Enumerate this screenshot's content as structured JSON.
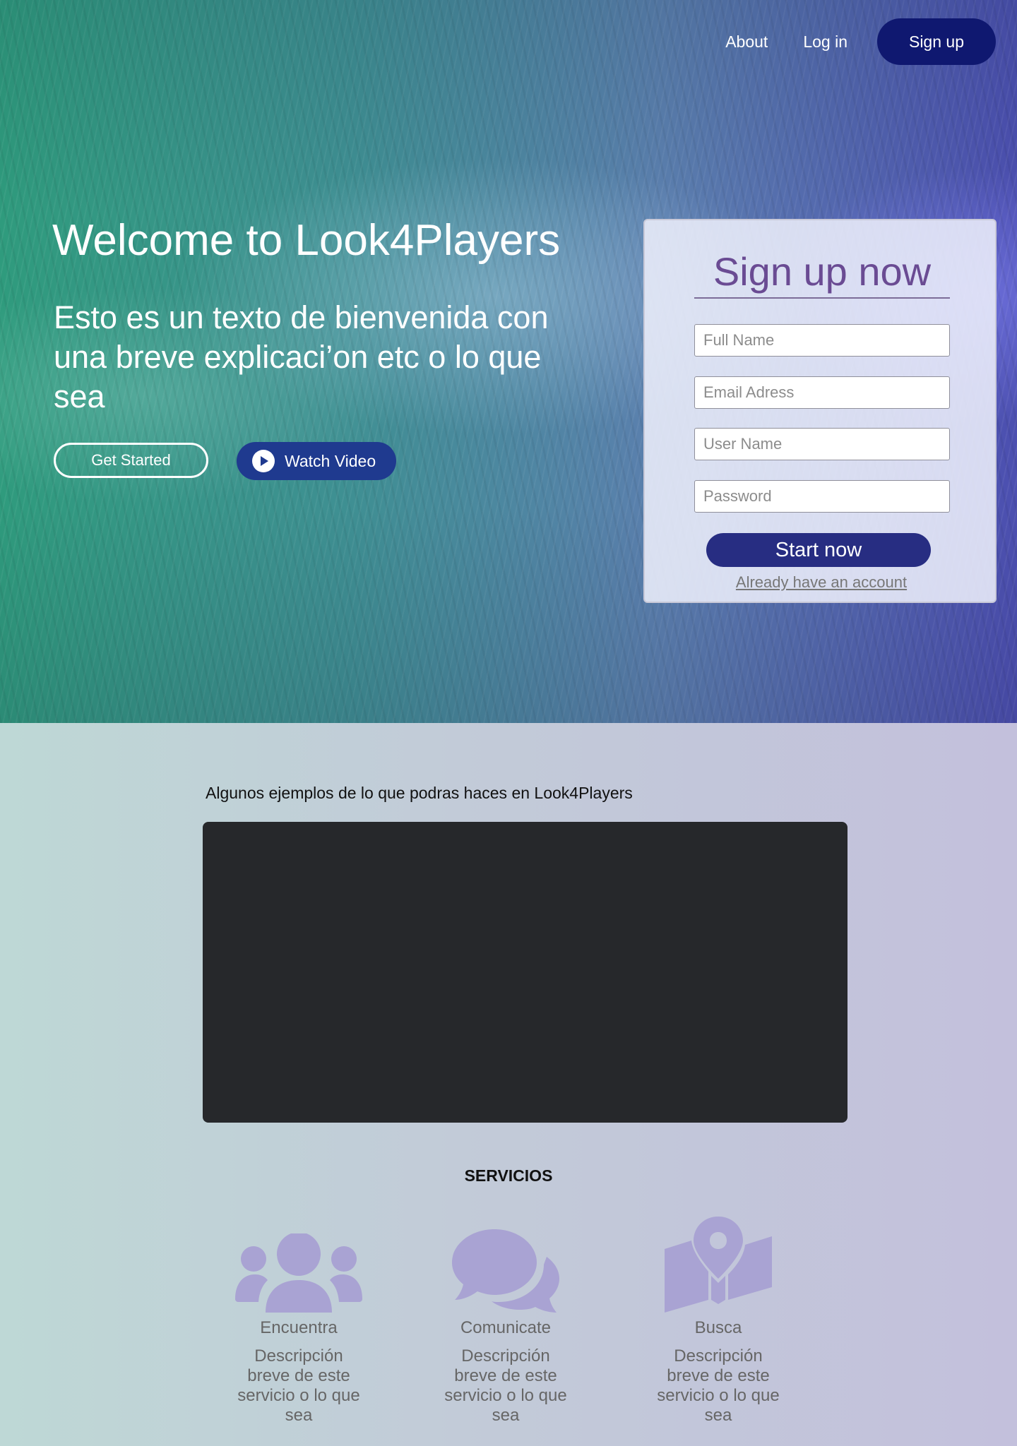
{
  "nav": {
    "about": "About",
    "login": "Log in",
    "signup": "Sign up"
  },
  "hero": {
    "title": "Welcome to Look4Players",
    "text": "Esto es un texto de bienvenida con una breve explicaci’on etc o lo que sea",
    "get_started": "Get Started",
    "watch_video": "Watch Video"
  },
  "signup_form": {
    "title": "Sign up now",
    "fields": [
      "Full Name",
      "Email Adress",
      "User Name",
      "Password"
    ],
    "submit": "Start now",
    "login_link": "Already have an account"
  },
  "examples_text": "Algunos ejemplos de lo que podras haces en Look4Players",
  "services": {
    "title": "SERVICIOS",
    "items": [
      {
        "name": "Encuentra",
        "description": "Descripción breve de este servicio o lo que sea",
        "icon": "users-icon"
      },
      {
        "name": "Comunicate",
        "description": "Descripción breve de este servicio o lo que sea",
        "icon": "comments-icon"
      },
      {
        "name": "Busca",
        "description": "Descripción breve de este servicio o lo que sea",
        "icon": "map-marker-icon"
      }
    ]
  },
  "colors": {
    "primary_dark": "#0f1870",
    "button_blue": "#1f3a8f",
    "start_button": "#272d82",
    "card_title": "#6a4b93",
    "service_icon": "#a9a3d3",
    "video_box": "#26282b"
  }
}
